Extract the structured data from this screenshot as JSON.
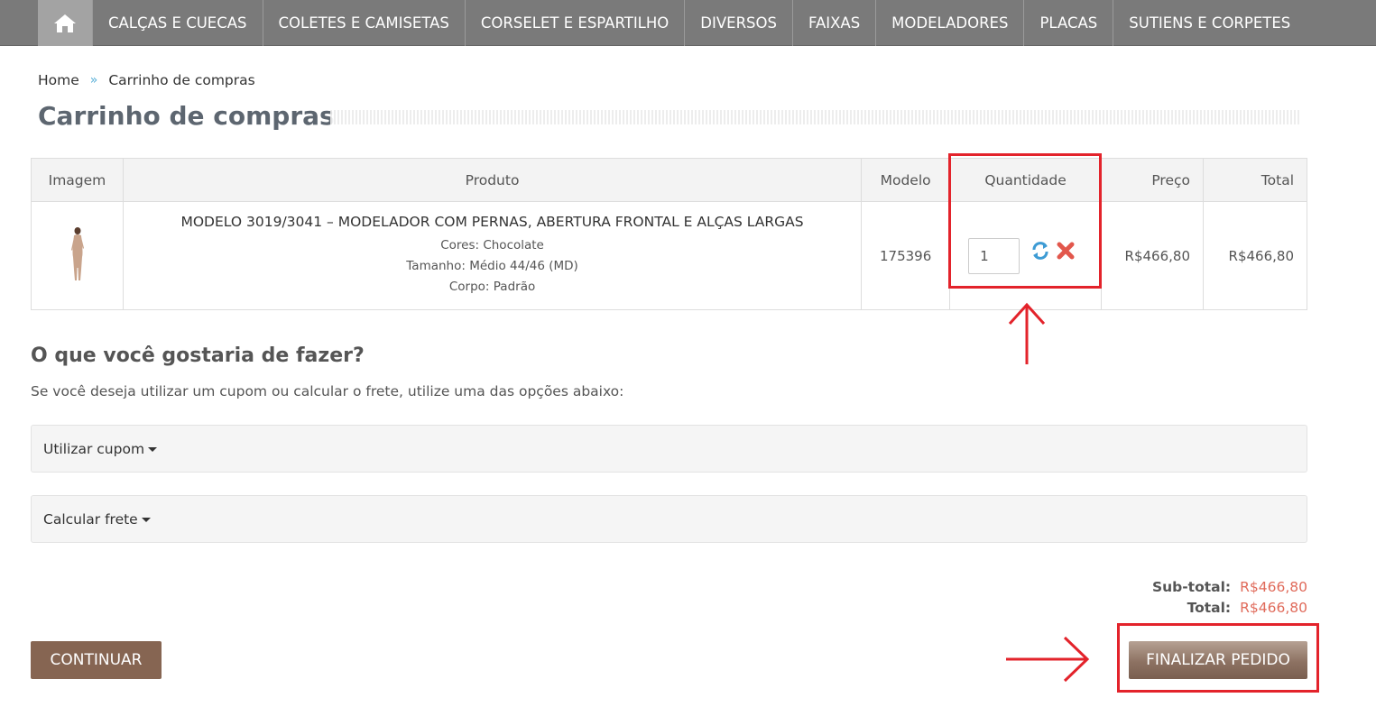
{
  "nav": {
    "home_icon": "home-icon",
    "items": [
      {
        "label": "CALÇAS E CUECAS"
      },
      {
        "label": "COLETES E CAMISETAS"
      },
      {
        "label": "CORSELET E ESPARTILHO"
      },
      {
        "label": "DIVERSOS"
      },
      {
        "label": "FAIXAS"
      },
      {
        "label": "MODELADORES"
      },
      {
        "label": "PLACAS"
      },
      {
        "label": "SUTIENS E CORPETES"
      }
    ]
  },
  "breadcrumb": {
    "home": "Home",
    "separator": "»",
    "current": "Carrinho de compras"
  },
  "page_title": "Carrinho de compras",
  "table": {
    "headers": {
      "image": "Imagem",
      "product": "Produto",
      "model": "Modelo",
      "quantity": "Quantidade",
      "price": "Preço",
      "total": "Total"
    },
    "rows": [
      {
        "product_name": "MODELO 3019/3041 – MODELADOR COM PERNAS, ABERTURA FRONTAL E ALÇAS LARGAS",
        "option_color": "Cores: Chocolate",
        "option_size": "Tamanho: Médio 44/46 (MD)",
        "option_body": "Corpo: Padrão",
        "model": "175396",
        "quantity": "1",
        "price": "R$466,80",
        "total": "R$466,80"
      }
    ]
  },
  "section": {
    "heading": "O que você gostaria de fazer?",
    "description": "Se você deseja utilizar um cupom ou calcular o frete, utilize uma das opções abaixo:",
    "coupon_label": "Utilizar cupom",
    "shipping_label": "Calcular frete"
  },
  "totals": {
    "subtotal_label": "Sub-total:",
    "subtotal_value": "R$466,80",
    "total_label": "Total:",
    "total_value": "R$466,80"
  },
  "buttons": {
    "continue": "CONTINUAR",
    "finalize": "FINALIZAR PEDIDO"
  },
  "colors": {
    "nav_bg": "#7a7a7a",
    "accent_brown": "#866552",
    "price_red": "#e06a5a",
    "annotation_red": "#e3232b"
  }
}
